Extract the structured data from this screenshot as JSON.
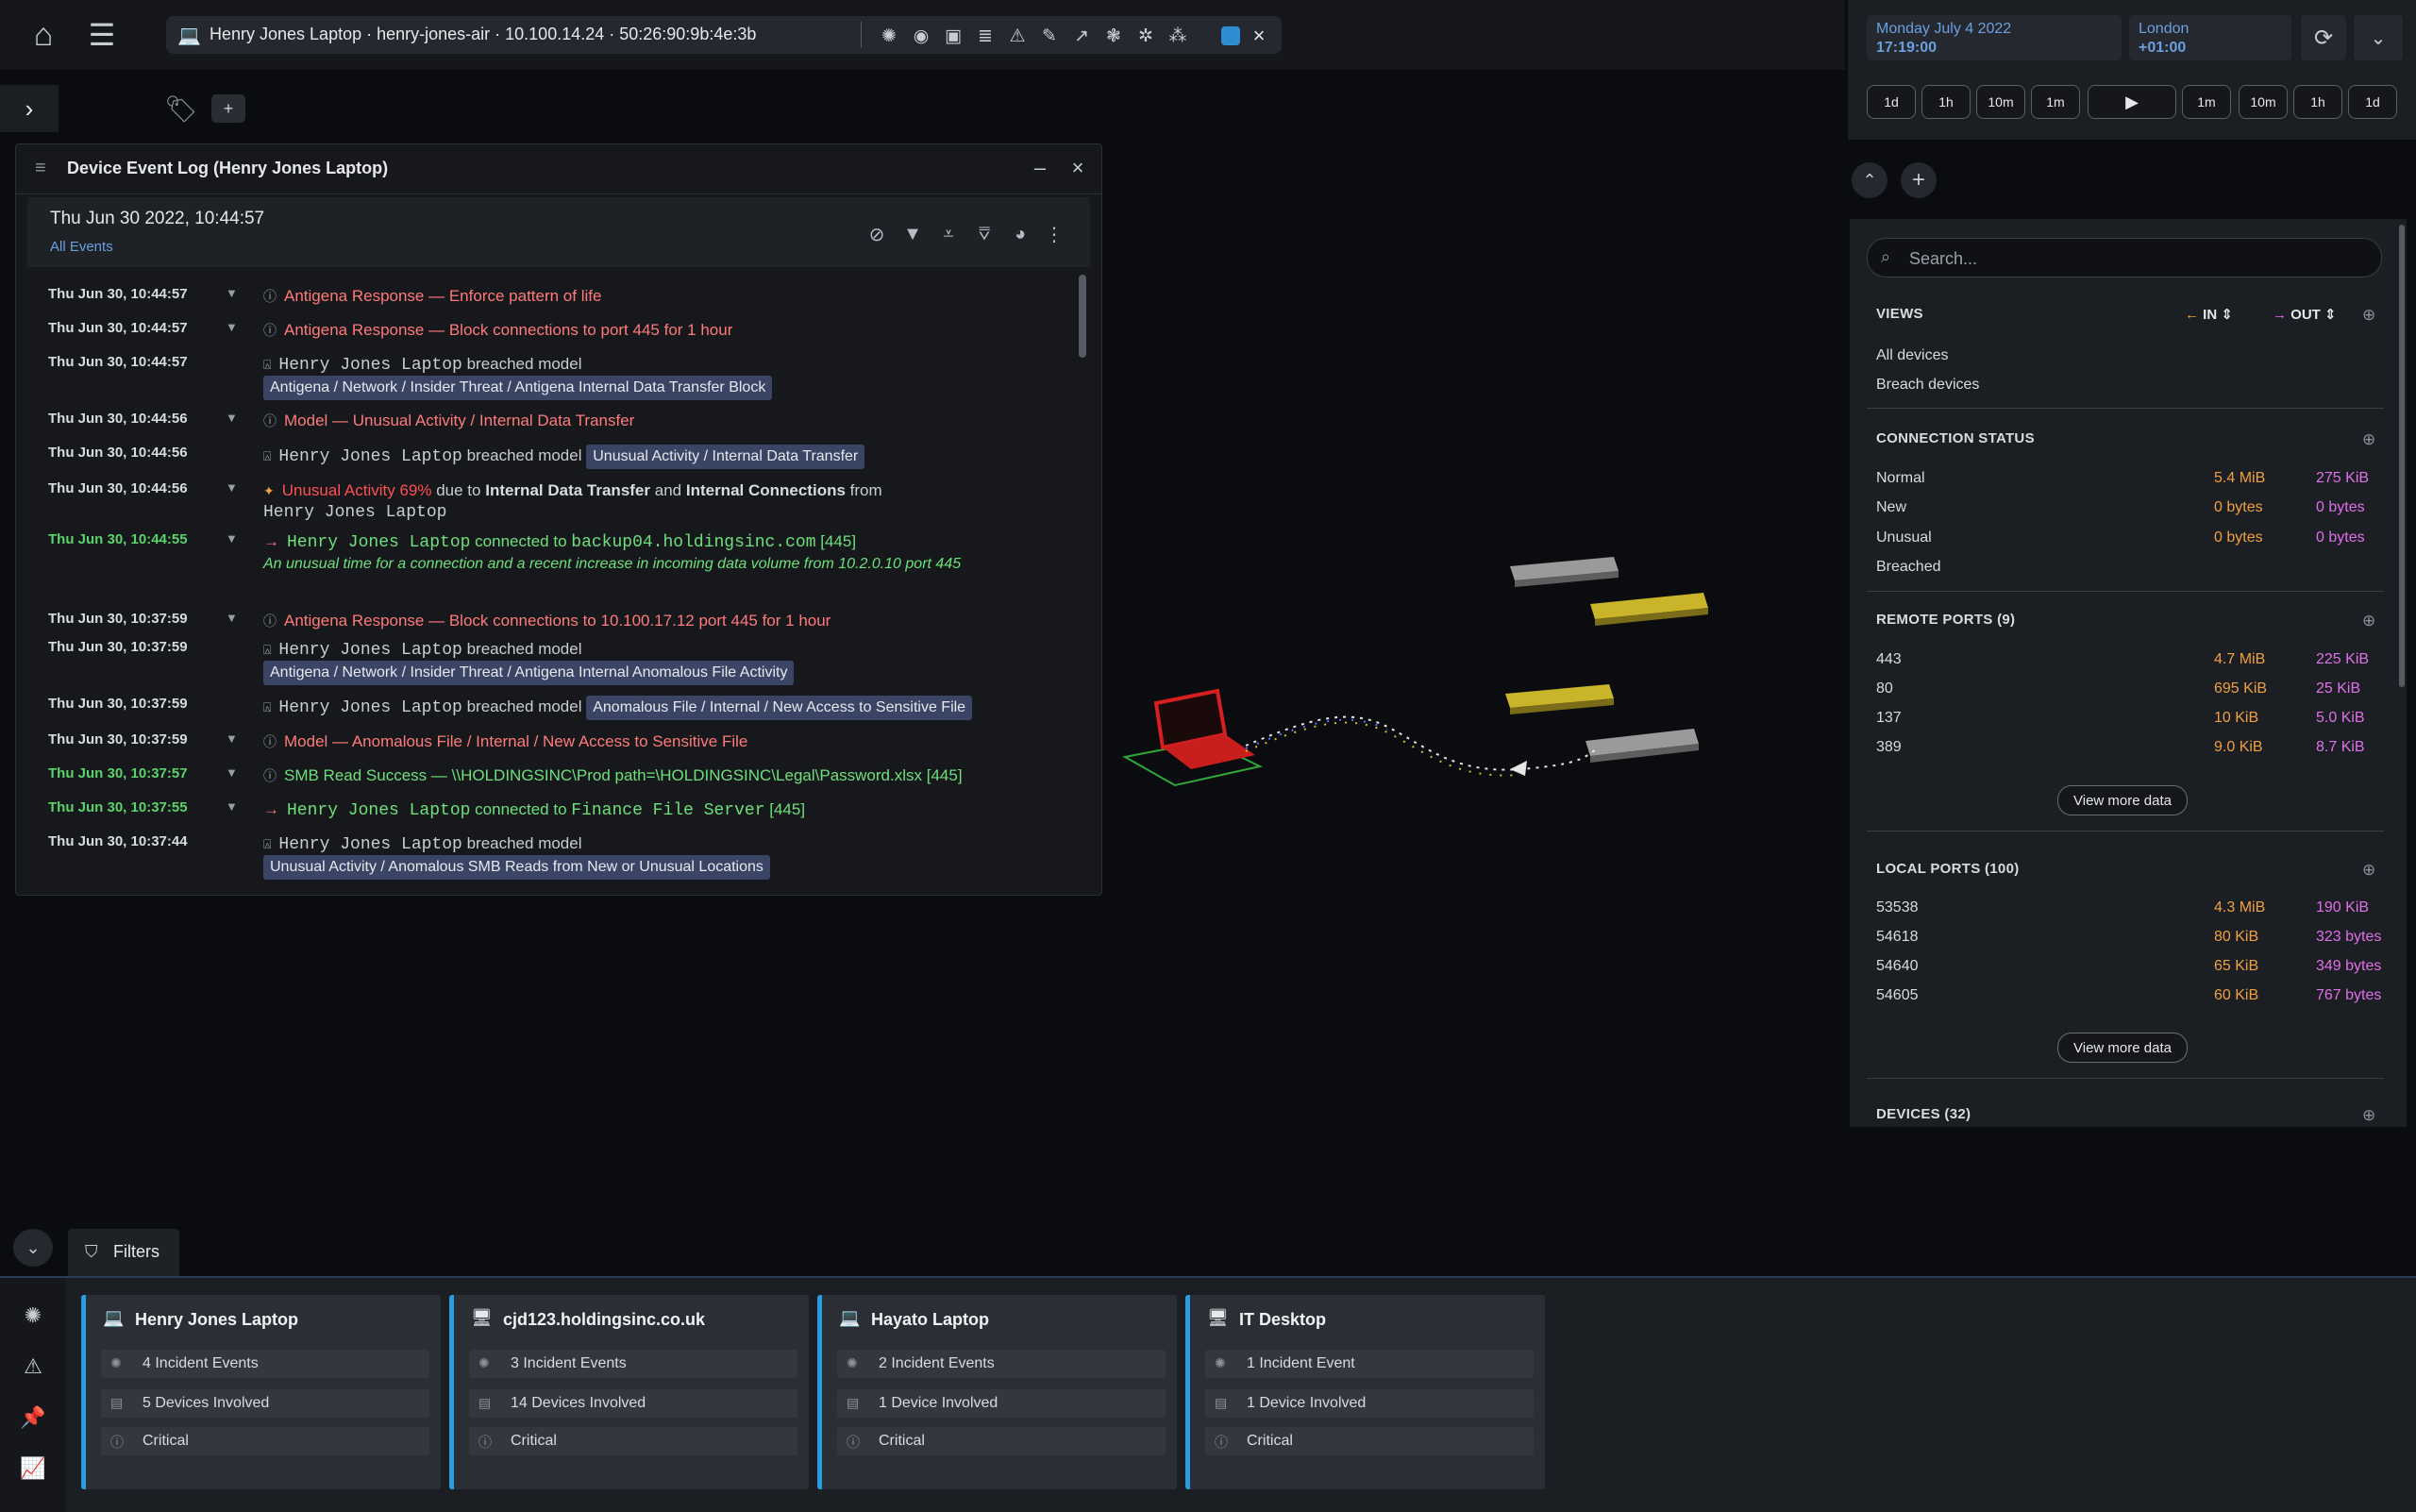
{
  "device_bar": {
    "title": "Henry Jones Laptop · henry-jones-air · 10.100.14.24 · 50:26:90:9b:4e:3b",
    "tool_icons": [
      "threat-icon",
      "chat-icon",
      "screen-icon",
      "list-icon",
      "warning-icon",
      "pen-icon",
      "chart-icon",
      "brain-icon",
      "network-icon",
      "cluster-icon",
      "color-swatch-icon"
    ],
    "close": "×"
  },
  "event_log": {
    "title": "Device Event Log (Henry Jones Laptop)",
    "date": "Thu Jun 30 2022, 10:44:57",
    "filter": "All Events",
    "events": [
      {
        "time": "Thu Jun 30, 10:44:57",
        "label": "Antigena Response —",
        "text": "Enforce pattern of life"
      },
      {
        "time": "Thu Jun 30, 10:44:57",
        "label": "Antigena Response —",
        "text": "Block connections to port 445 for 1 hour"
      },
      {
        "time": "Thu Jun 30, 10:44:57",
        "device": "Henry Jones Laptop",
        "mid": "breached model",
        "tag": "Antigena / Network / Insider Threat / Antigena Internal Data Transfer Block"
      },
      {
        "time": "Thu Jun 30, 10:44:56",
        "label": "Model —",
        "text": "Unusual Activity / Internal Data Transfer"
      },
      {
        "time": "Thu Jun 30, 10:44:56",
        "device": "Henry Jones Laptop",
        "mid": "breached model",
        "tag": "Unusual Activity / Internal Data Transfer"
      },
      {
        "time": "Thu Jun 30, 10:44:56",
        "label": "Unusual Activity 69%",
        "t1": "due to",
        "b1": "Internal Data Transfer",
        "t2": "and",
        "b2": "Internal Connections",
        "t3": "from",
        "device": "Henry Jones Laptop"
      },
      {
        "time": "Thu Jun 30, 10:44:55",
        "device": "Henry Jones Laptop",
        "mid": "connected to",
        "target": "backup04.holdingsinc.com",
        "port": "[445]",
        "note": "An unusual time for a connection and a recent increase in incoming data volume from 10.2.0.10 port 445"
      },
      {
        "time": "Thu Jun 30, 10:37:59",
        "label": "Antigena Response —",
        "text": "Block connections to 10.100.17.12 port 445 for 1 hour"
      },
      {
        "time": "Thu Jun 30, 10:37:59",
        "device": "Henry Jones Laptop",
        "mid": "breached model",
        "tag": "Antigena / Network / Insider Threat / Antigena Internal Anomalous File Activity"
      },
      {
        "time": "Thu Jun 30, 10:37:59",
        "device": "Henry Jones Laptop",
        "mid": "breached model",
        "tag": "Anomalous File / Internal / New Access to Sensitive File"
      },
      {
        "time": "Thu Jun 30, 10:37:59",
        "label": "Model —",
        "text": "Anomalous File / Internal / New Access to Sensitive File"
      },
      {
        "time": "Thu Jun 30, 10:37:57",
        "label": "SMB Read Success —",
        "text": "\\\\HOLDINGSINC\\Prod path=\\HOLDINGSINC\\Legal\\Password.xlsx",
        "port": "[445]"
      },
      {
        "time": "Thu Jun 30, 10:37:55",
        "device": "Henry Jones Laptop",
        "mid": "connected to",
        "target": "Finance File Server",
        "port": "[445]"
      },
      {
        "time": "Thu Jun 30, 10:37:44",
        "device": "Henry Jones Laptop",
        "mid": "breached model",
        "tag": "Unusual Activity / Anomalous SMB Reads from New or Unusual Locations"
      }
    ]
  },
  "time_panel": {
    "date": "Monday July 4 2022",
    "time": "17:19:00",
    "city": "London",
    "offset": "+01:00",
    "steps": [
      "1d",
      "1h",
      "10m",
      "1m",
      "1m",
      "10m",
      "1h",
      "1d"
    ]
  },
  "side_panel": {
    "search_placeholder": "Search...",
    "views_title": "VIEWS",
    "in_label": "IN",
    "out_label": "OUT",
    "views": [
      "All devices",
      "Breach devices"
    ],
    "connection_title": "CONNECTION STATUS",
    "connection": [
      {
        "k": "Normal",
        "in": "5.4 MiB",
        "out": "275 KiB"
      },
      {
        "k": "New",
        "in": "0 bytes",
        "out": "0 bytes"
      },
      {
        "k": "Unusual",
        "in": "0 bytes",
        "out": "0 bytes"
      },
      {
        "k": "Breached",
        "in": "",
        "out": ""
      }
    ],
    "remote_title": "REMOTE PORTS (9)",
    "remote": [
      {
        "k": "443",
        "in": "4.7 MiB",
        "out": "225 KiB"
      },
      {
        "k": "80",
        "in": "695 KiB",
        "out": "25 KiB"
      },
      {
        "k": "137",
        "in": "10 KiB",
        "out": "5.0 KiB"
      },
      {
        "k": "389",
        "in": "9.0 KiB",
        "out": "8.7 KiB"
      }
    ],
    "local_title": "LOCAL PORTS (100)",
    "local": [
      {
        "k": "53538",
        "in": "4.3 MiB",
        "out": "190 KiB"
      },
      {
        "k": "54618",
        "in": "80 KiB",
        "out": "323 bytes"
      },
      {
        "k": "54640",
        "in": "65 KiB",
        "out": "349 bytes"
      },
      {
        "k": "54605",
        "in": "60 KiB",
        "out": "767 bytes"
      }
    ],
    "view_more": "View more data",
    "devices_title": "DEVICES (32)"
  },
  "filters_label": "Filters",
  "cards": [
    {
      "title": "Henry Jones Laptop",
      "icon": "laptop-icon",
      "incidents": "4 Incident Events",
      "devices": "5 Devices Involved",
      "severity": "Critical"
    },
    {
      "title": "cjd123.holdingsinc.co.uk",
      "icon": "desktop-icon",
      "incidents": "3 Incident Events",
      "devices": "14 Devices Involved",
      "severity": "Critical"
    },
    {
      "title": "Hayato Laptop",
      "icon": "laptop-icon",
      "incidents": "2 Incident Events",
      "devices": "1 Device Involved",
      "severity": "Critical"
    },
    {
      "title": "IT Desktop",
      "icon": "desktop-icon",
      "incidents": "1 Incident Event",
      "devices": "1 Device Involved",
      "severity": "Critical"
    }
  ]
}
